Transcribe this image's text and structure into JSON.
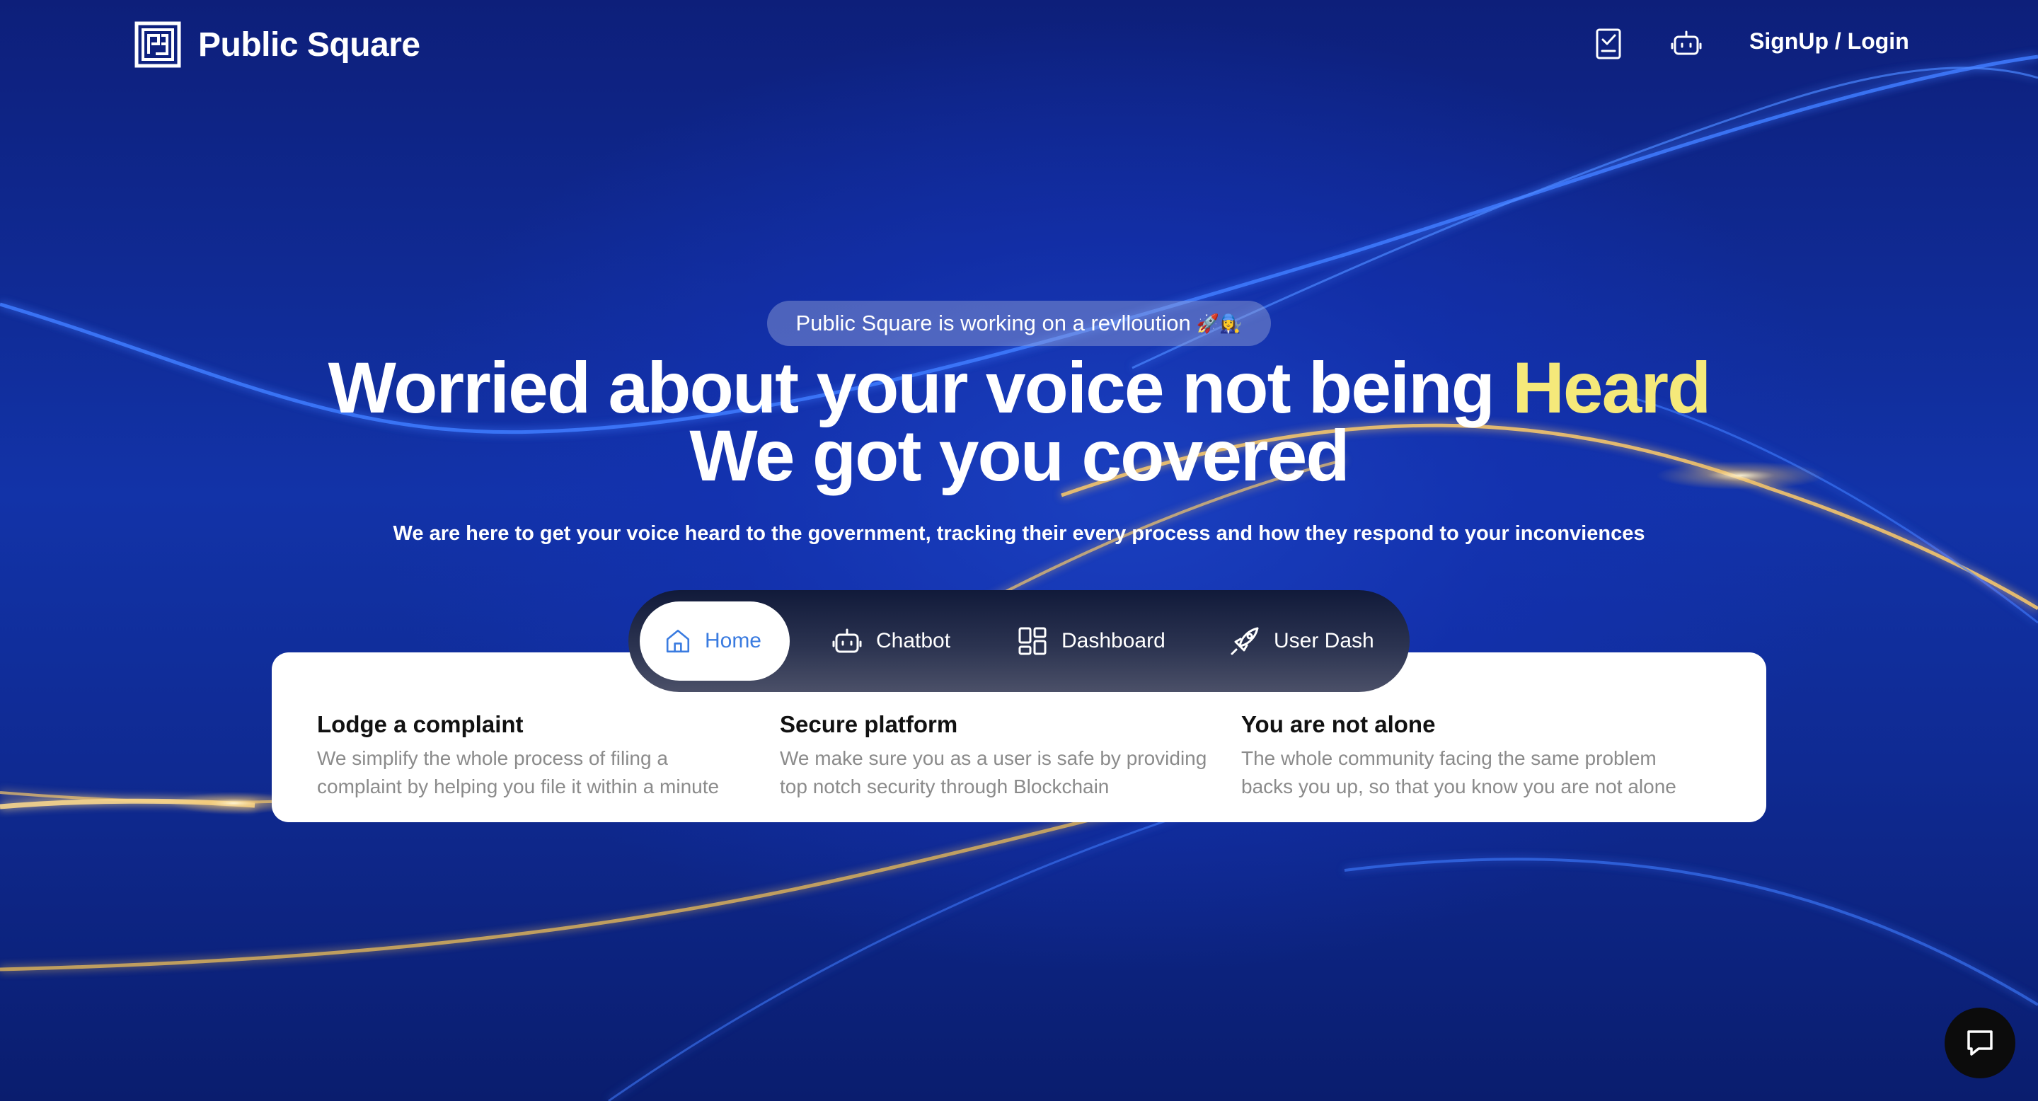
{
  "brand": {
    "name": "Public Square"
  },
  "nav": {
    "icons": [
      "clipboard-check-icon",
      "robot-icon"
    ],
    "login_label": "SignUp / Login"
  },
  "hero": {
    "pill_text": "Public Square is working on a revlloution",
    "pill_emoji": "🚀👩‍🔧",
    "headline_part1": "Worried about your voice not being ",
    "headline_highlight": "Heard",
    "headline_line2": "We got you covered",
    "subtext": "We are here to get your voice heard to the government, tracking their every process and how they respond to your inconviences"
  },
  "tabs": [
    {
      "label": "Home",
      "icon": "home-icon",
      "active": true
    },
    {
      "label": "Chatbot",
      "icon": "robot-icon",
      "active": false
    },
    {
      "label": "Dashboard",
      "icon": "dashboard-icon",
      "active": false
    },
    {
      "label": "User Dash",
      "icon": "rocket-icon",
      "active": false
    }
  ],
  "features": [
    {
      "title": "Lodge a complaint",
      "description": "We simplify the whole process of filing a complaint by helping you file it within a minute"
    },
    {
      "title": "Secure platform",
      "description": "We make sure you as a user is safe by providing top notch security through Blockchain"
    },
    {
      "title": "You are not alone",
      "description": "The whole community facing the same problem backs you up, so that you know you are not alone"
    }
  ],
  "colors": {
    "background": "#1233a8",
    "highlight": "#f5e97a",
    "active_tab_text": "#3a7be0",
    "glow_gold": "#f2c46b",
    "glow_blue": "#3f7bff"
  },
  "chat_widget": {
    "icon": "chat-bubble-icon"
  }
}
